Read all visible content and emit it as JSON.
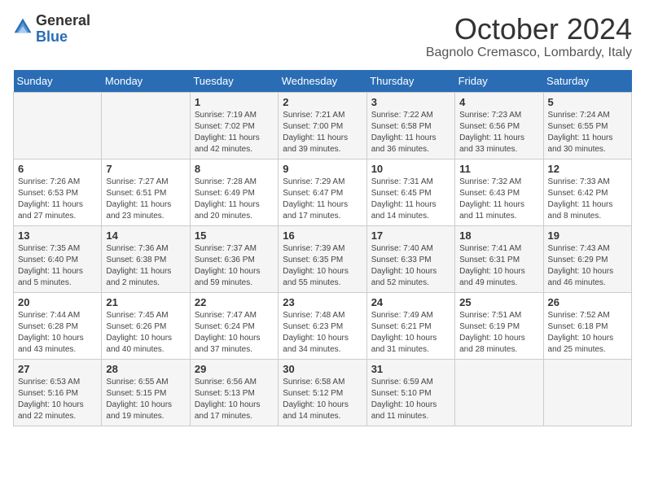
{
  "header": {
    "logo_general": "General",
    "logo_blue": "Blue",
    "title": "October 2024",
    "subtitle": "Bagnolo Cremasco, Lombardy, Italy"
  },
  "calendar": {
    "days_of_week": [
      "Sunday",
      "Monday",
      "Tuesday",
      "Wednesday",
      "Thursday",
      "Friday",
      "Saturday"
    ],
    "weeks": [
      [
        {
          "day": "",
          "info": ""
        },
        {
          "day": "",
          "info": ""
        },
        {
          "day": "1",
          "info": "Sunrise: 7:19 AM\nSunset: 7:02 PM\nDaylight: 11 hours and 42 minutes."
        },
        {
          "day": "2",
          "info": "Sunrise: 7:21 AM\nSunset: 7:00 PM\nDaylight: 11 hours and 39 minutes."
        },
        {
          "day": "3",
          "info": "Sunrise: 7:22 AM\nSunset: 6:58 PM\nDaylight: 11 hours and 36 minutes."
        },
        {
          "day": "4",
          "info": "Sunrise: 7:23 AM\nSunset: 6:56 PM\nDaylight: 11 hours and 33 minutes."
        },
        {
          "day": "5",
          "info": "Sunrise: 7:24 AM\nSunset: 6:55 PM\nDaylight: 11 hours and 30 minutes."
        }
      ],
      [
        {
          "day": "6",
          "info": "Sunrise: 7:26 AM\nSunset: 6:53 PM\nDaylight: 11 hours and 27 minutes."
        },
        {
          "day": "7",
          "info": "Sunrise: 7:27 AM\nSunset: 6:51 PM\nDaylight: 11 hours and 23 minutes."
        },
        {
          "day": "8",
          "info": "Sunrise: 7:28 AM\nSunset: 6:49 PM\nDaylight: 11 hours and 20 minutes."
        },
        {
          "day": "9",
          "info": "Sunrise: 7:29 AM\nSunset: 6:47 PM\nDaylight: 11 hours and 17 minutes."
        },
        {
          "day": "10",
          "info": "Sunrise: 7:31 AM\nSunset: 6:45 PM\nDaylight: 11 hours and 14 minutes."
        },
        {
          "day": "11",
          "info": "Sunrise: 7:32 AM\nSunset: 6:43 PM\nDaylight: 11 hours and 11 minutes."
        },
        {
          "day": "12",
          "info": "Sunrise: 7:33 AM\nSunset: 6:42 PM\nDaylight: 11 hours and 8 minutes."
        }
      ],
      [
        {
          "day": "13",
          "info": "Sunrise: 7:35 AM\nSunset: 6:40 PM\nDaylight: 11 hours and 5 minutes."
        },
        {
          "day": "14",
          "info": "Sunrise: 7:36 AM\nSunset: 6:38 PM\nDaylight: 11 hours and 2 minutes."
        },
        {
          "day": "15",
          "info": "Sunrise: 7:37 AM\nSunset: 6:36 PM\nDaylight: 10 hours and 59 minutes."
        },
        {
          "day": "16",
          "info": "Sunrise: 7:39 AM\nSunset: 6:35 PM\nDaylight: 10 hours and 55 minutes."
        },
        {
          "day": "17",
          "info": "Sunrise: 7:40 AM\nSunset: 6:33 PM\nDaylight: 10 hours and 52 minutes."
        },
        {
          "day": "18",
          "info": "Sunrise: 7:41 AM\nSunset: 6:31 PM\nDaylight: 10 hours and 49 minutes."
        },
        {
          "day": "19",
          "info": "Sunrise: 7:43 AM\nSunset: 6:29 PM\nDaylight: 10 hours and 46 minutes."
        }
      ],
      [
        {
          "day": "20",
          "info": "Sunrise: 7:44 AM\nSunset: 6:28 PM\nDaylight: 10 hours and 43 minutes."
        },
        {
          "day": "21",
          "info": "Sunrise: 7:45 AM\nSunset: 6:26 PM\nDaylight: 10 hours and 40 minutes."
        },
        {
          "day": "22",
          "info": "Sunrise: 7:47 AM\nSunset: 6:24 PM\nDaylight: 10 hours and 37 minutes."
        },
        {
          "day": "23",
          "info": "Sunrise: 7:48 AM\nSunset: 6:23 PM\nDaylight: 10 hours and 34 minutes."
        },
        {
          "day": "24",
          "info": "Sunrise: 7:49 AM\nSunset: 6:21 PM\nDaylight: 10 hours and 31 minutes."
        },
        {
          "day": "25",
          "info": "Sunrise: 7:51 AM\nSunset: 6:19 PM\nDaylight: 10 hours and 28 minutes."
        },
        {
          "day": "26",
          "info": "Sunrise: 7:52 AM\nSunset: 6:18 PM\nDaylight: 10 hours and 25 minutes."
        }
      ],
      [
        {
          "day": "27",
          "info": "Sunrise: 6:53 AM\nSunset: 5:16 PM\nDaylight: 10 hours and 22 minutes."
        },
        {
          "day": "28",
          "info": "Sunrise: 6:55 AM\nSunset: 5:15 PM\nDaylight: 10 hours and 19 minutes."
        },
        {
          "day": "29",
          "info": "Sunrise: 6:56 AM\nSunset: 5:13 PM\nDaylight: 10 hours and 17 minutes."
        },
        {
          "day": "30",
          "info": "Sunrise: 6:58 AM\nSunset: 5:12 PM\nDaylight: 10 hours and 14 minutes."
        },
        {
          "day": "31",
          "info": "Sunrise: 6:59 AM\nSunset: 5:10 PM\nDaylight: 10 hours and 11 minutes."
        },
        {
          "day": "",
          "info": ""
        },
        {
          "day": "",
          "info": ""
        }
      ]
    ]
  }
}
